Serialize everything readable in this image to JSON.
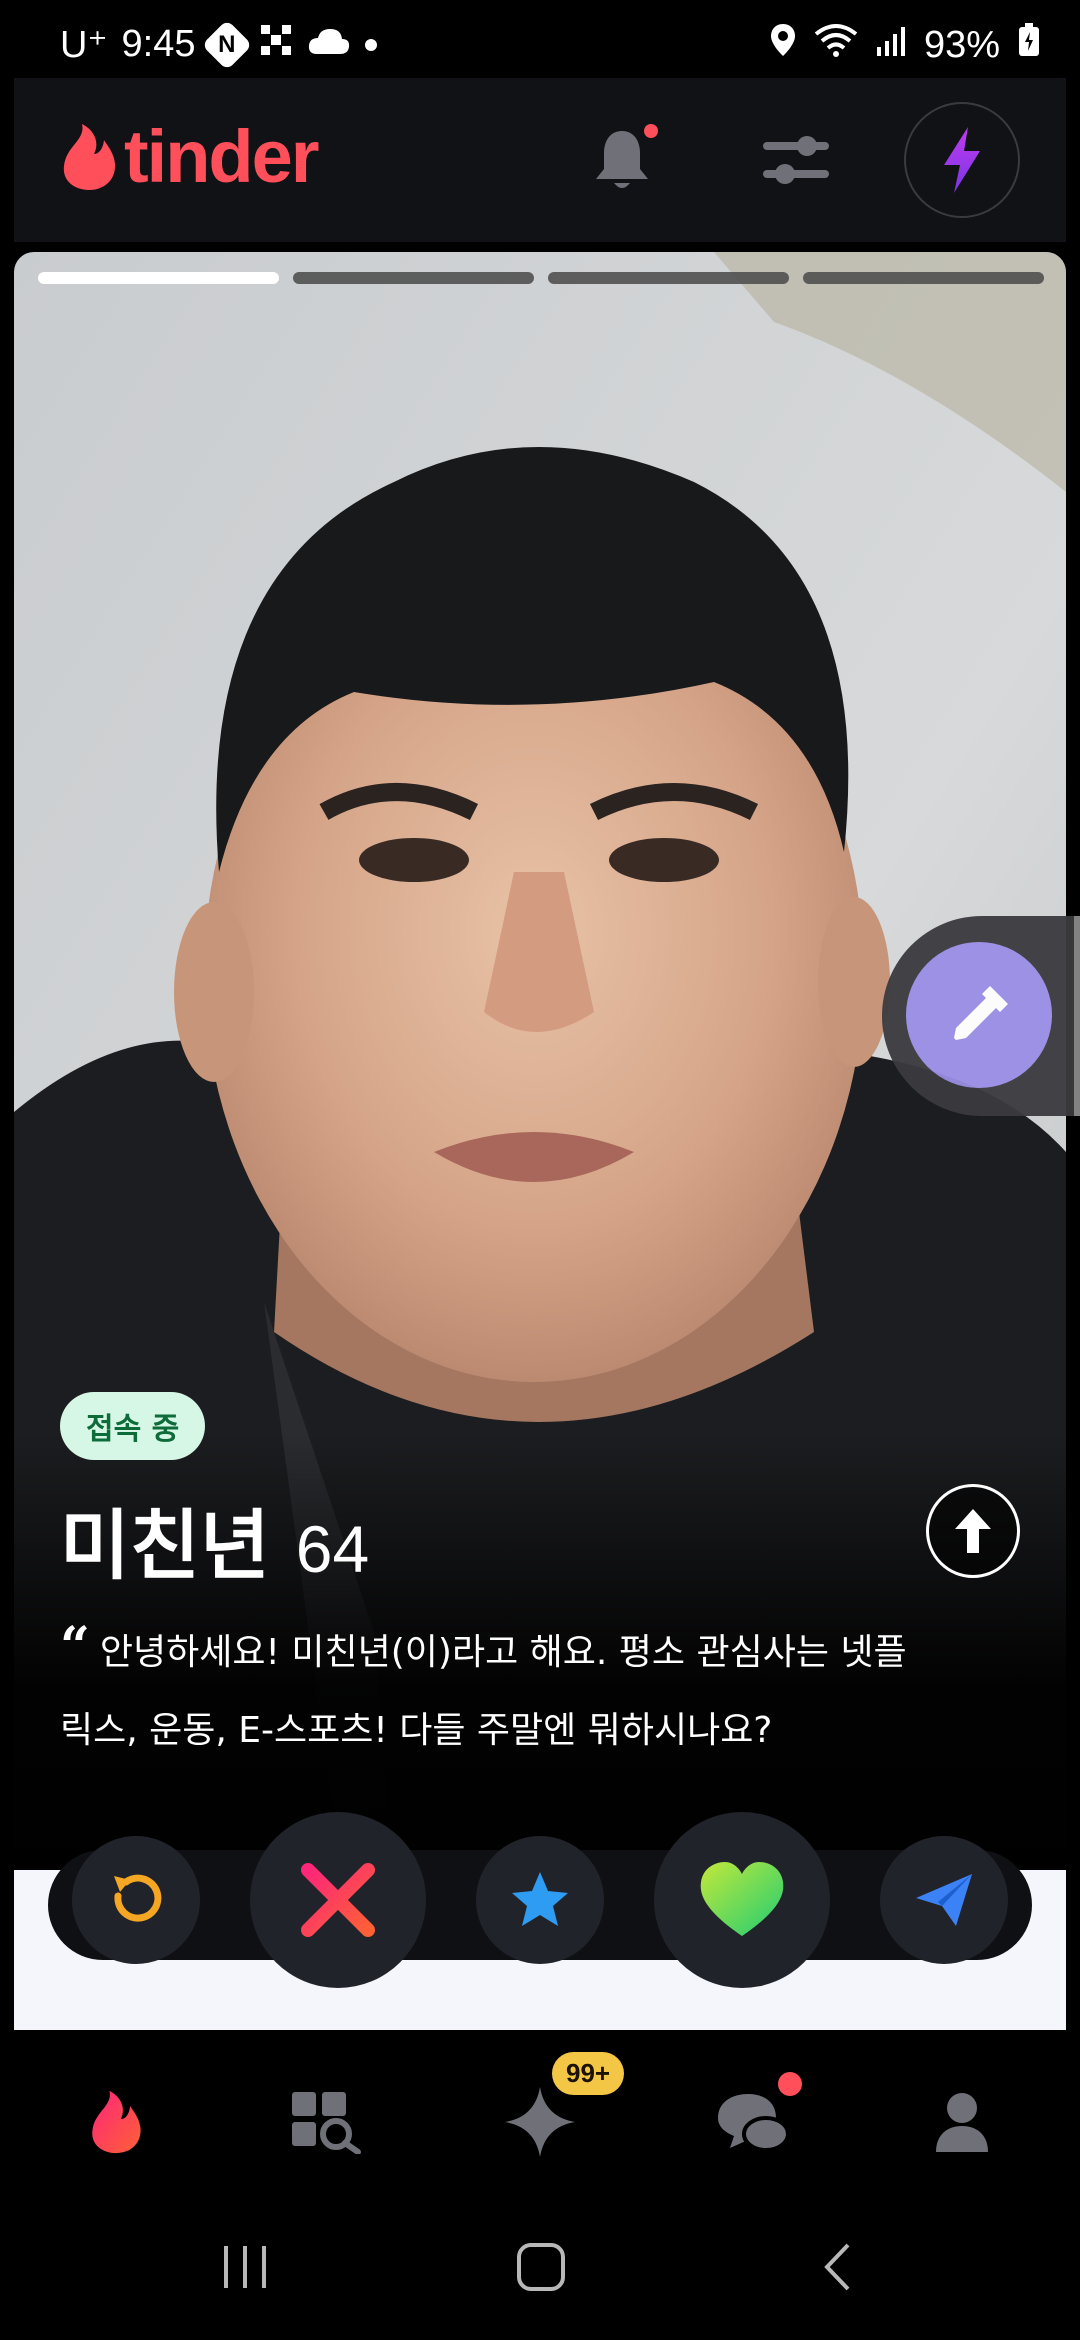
{
  "status_bar": {
    "carrier": "U⁺",
    "time": "9:45",
    "network_badge": "N",
    "battery": "93%"
  },
  "header": {
    "logo_text": "tinder",
    "brand_color": "#fe4f5a",
    "icons": [
      "bell-icon",
      "filters-icon",
      "boost-bolt-icon"
    ]
  },
  "card": {
    "photo_count": 4,
    "active_photo": 1,
    "online_status": "접속 중",
    "name": "미친년",
    "age": "64",
    "bio_line1": "안녕하세요! 미친년(이)라고 해요. 평소 관심사는 넷플",
    "bio_line2": "릭스, 운동, E-스포츠! 다들 주말엔 뭐하시나요?"
  },
  "actions": [
    "rewind-icon",
    "nope-x-icon",
    "super-like-star-icon",
    "like-heart-icon",
    "super-message-send-icon"
  ],
  "bottom_nav": {
    "items": [
      "home-flame-icon",
      "explore-icon",
      "gold-sparkle-icon",
      "chat-icon",
      "profile-icon"
    ],
    "gold_badge": "99+"
  },
  "colors": {
    "accent": "#fe4f5a",
    "online_bg": "#d6f7e5",
    "online_text": "#0e6b3a",
    "side_button": "#9b8ee6"
  }
}
